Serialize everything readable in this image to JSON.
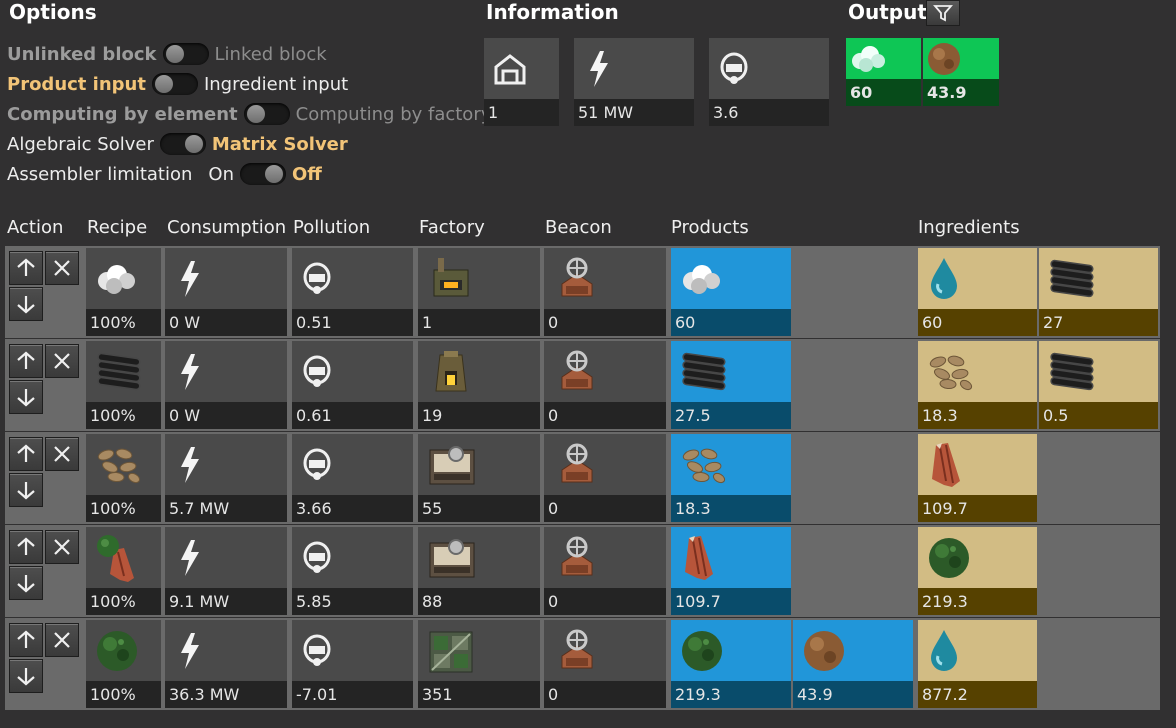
{
  "options": {
    "title": "Options",
    "rows": [
      {
        "left": "Unlinked block",
        "right": "Linked block",
        "switch": "left",
        "left_style": "bold-dim",
        "right_style": "dim"
      },
      {
        "left": "Product input",
        "right": "Ingredient input",
        "switch": "left",
        "left_style": "accent",
        "right_style": "lbl"
      },
      {
        "left": "Computing by element",
        "right": "Computing by factory",
        "switch": "left",
        "left_style": "bold-dim",
        "right_style": "dim"
      },
      {
        "left": "Algebraic Solver",
        "right": "Matrix Solver",
        "switch": "right",
        "left_style": "lbl",
        "right_style": "accent"
      }
    ],
    "assembler": {
      "label": "Assembler limitation",
      "on": "On",
      "off": "Off"
    }
  },
  "information": {
    "title": "Information",
    "tiles": [
      {
        "icon": "building-icon",
        "value": "1"
      },
      {
        "icon": "power-icon",
        "value": "51 MW"
      },
      {
        "icon": "pollution-icon",
        "value": "3.6"
      }
    ]
  },
  "output": {
    "title": "Output",
    "filter_icon": "filter-icon",
    "items": [
      {
        "icon": "steam-icon",
        "value": "60"
      },
      {
        "icon": "wood-ball-icon",
        "value": "43.9"
      }
    ]
  },
  "columns": [
    "Action",
    "Recipe",
    "Consumption",
    "Pollution",
    "Factory",
    "Beacon",
    "Products",
    "Ingredients"
  ],
  "rows": [
    {
      "recipe": {
        "icon": "steam-icon",
        "value": "100%"
      },
      "consumption": "0 W",
      "pollution": "0.51",
      "factory": {
        "icon": "boiler-icon",
        "value": "1"
      },
      "beacon": "0",
      "products": [
        {
          "icon": "steam-icon",
          "value": "60"
        }
      ],
      "ingredients": [
        {
          "icon": "water-icon",
          "value": "60"
        },
        {
          "icon": "coal-logs-icon",
          "value": "27"
        }
      ]
    },
    {
      "recipe": {
        "icon": "coal-logs-icon",
        "value": "100%"
      },
      "consumption": "0 W",
      "pollution": "0.61",
      "factory": {
        "icon": "furnace-icon",
        "value": "19"
      },
      "beacon": "0",
      "products": [
        {
          "icon": "coal-logs-icon",
          "value": "27.5"
        }
      ],
      "ingredients": [
        {
          "icon": "wood-pellets-icon",
          "value": "18.3"
        },
        {
          "icon": "coal-logs-icon",
          "value": "0.5"
        }
      ]
    },
    {
      "recipe": {
        "icon": "wood-pellets-icon",
        "value": "100%"
      },
      "consumption": "5.7 MW",
      "pollution": "3.66",
      "factory": {
        "icon": "assembler-icon",
        "value": "55"
      },
      "beacon": "0",
      "products": [
        {
          "icon": "wood-pellets-icon",
          "value": "18.3"
        }
      ],
      "ingredients": [
        {
          "icon": "bark-icon",
          "value": "109.7"
        }
      ]
    },
    {
      "recipe": {
        "icon": "bark-from-moss-icon",
        "value": "100%"
      },
      "consumption": "9.1 MW",
      "pollution": "5.85",
      "factory": {
        "icon": "assembler-icon",
        "value": "88"
      },
      "beacon": "0",
      "products": [
        {
          "icon": "bark-icon",
          "value": "109.7"
        }
      ],
      "ingredients": [
        {
          "icon": "moss-ball-icon",
          "value": "219.3"
        }
      ]
    },
    {
      "recipe": {
        "icon": "moss-ball-icon",
        "value": "100%"
      },
      "consumption": "36.3 MW",
      "pollution": "-7.01",
      "factory": {
        "icon": "moss-farm-icon",
        "value": "351"
      },
      "beacon": "0",
      "products": [
        {
          "icon": "moss-ball-icon",
          "value": "219.3"
        },
        {
          "icon": "wood-ball-icon",
          "value": "43.9"
        }
      ],
      "ingredients": [
        {
          "icon": "water-icon",
          "value": "877.2"
        }
      ]
    }
  ]
}
